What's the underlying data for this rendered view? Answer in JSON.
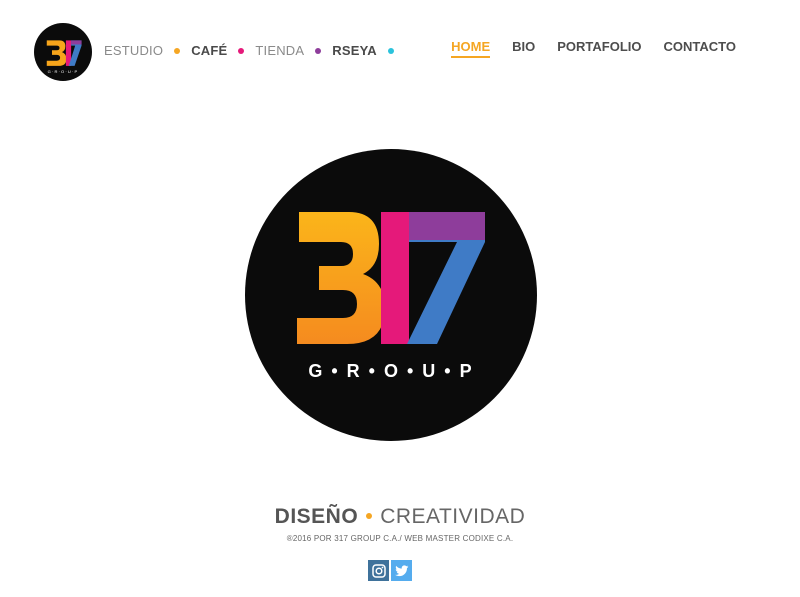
{
  "header": {
    "logo_alt": "317 GROUP",
    "brand_items": [
      {
        "label": "ESTUDIO",
        "bold": false,
        "dot_color": "#f5a623"
      },
      {
        "label": "CAFÉ",
        "bold": true,
        "dot_color": "#e5197a"
      },
      {
        "label": "TIENDA",
        "bold": false,
        "dot_color": "#8e3d9b"
      },
      {
        "label": "RSEYA",
        "bold": true,
        "dot_color": "#2bc3dc"
      }
    ],
    "nav": [
      {
        "label": "HOME",
        "active": true
      },
      {
        "label": "BIO",
        "active": false
      },
      {
        "label": "PORTAFOLIO",
        "active": false
      },
      {
        "label": "CONTACTO",
        "active": false
      }
    ]
  },
  "hero": {
    "logo_number": "317",
    "logo_word": "GROUP"
  },
  "tagline": {
    "part1": "DISEÑO",
    "part2": "CREATIVIDAD"
  },
  "footer": {
    "copyright": "®2016 POR 317 GROUP C.A./ WEB MASTER CODIXE C.A."
  },
  "social": [
    {
      "icon": "instagram-icon",
      "color": "#3f729b"
    },
    {
      "icon": "twitter-icon",
      "color": "#55acee"
    }
  ],
  "colors": {
    "accent": "#f5a623",
    "magenta": "#e5197a",
    "purple": "#8e3d9b",
    "blue": "#3f7bc6",
    "cyan": "#2bc3dc",
    "orange": "#f7901e"
  }
}
